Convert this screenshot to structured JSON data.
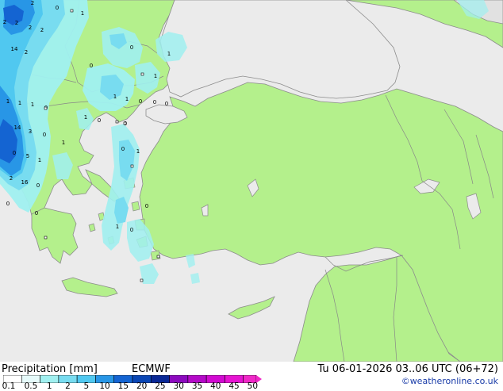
{
  "footer": {
    "title": "Precipitation [mm]",
    "model": "ECMWF",
    "valid_time": "Tu 06-01-2026 03..06 UTC (06+72)",
    "credit": "©weatheronline.co.uk"
  },
  "legend": {
    "labels": [
      "0.1",
      "0.5",
      "1",
      "2",
      "5",
      "10",
      "15",
      "20",
      "25",
      "30",
      "35",
      "40",
      "45",
      "50"
    ],
    "colors": [
      "#ffffff",
      "#e6fafa",
      "#a0f0f0",
      "#78dcf0",
      "#50c8f0",
      "#2896e6",
      "#1464d2",
      "#0a46b4",
      "#0a2896",
      "#8c0abe",
      "#b40ac8",
      "#d20ad2",
      "#e614d2",
      "#f028c8"
    ]
  },
  "map_labels": [
    {
      "text": "2"
    },
    {
      "text": "0"
    },
    {
      "text": "1"
    },
    {
      "text": "2"
    },
    {
      "text": "2"
    },
    {
      "text": "2"
    },
    {
      "text": "14"
    },
    {
      "text": "2"
    },
    {
      "text": "0"
    },
    {
      "text": "0"
    },
    {
      "text": "1"
    },
    {
      "text": "1"
    },
    {
      "text": "1"
    },
    {
      "text": "1"
    },
    {
      "text": "0"
    },
    {
      "text": "1"
    },
    {
      "text": "14"
    },
    {
      "text": "3"
    },
    {
      "text": "0"
    },
    {
      "text": "0"
    },
    {
      "text": "5"
    },
    {
      "text": "1"
    },
    {
      "text": "2"
    },
    {
      "text": "16"
    },
    {
      "text": "0"
    },
    {
      "text": "0"
    },
    {
      "text": "0"
    },
    {
      "text": "1"
    },
    {
      "text": "0"
    },
    {
      "text": "0"
    },
    {
      "text": "1"
    },
    {
      "text": "0"
    },
    {
      "text": "1"
    },
    {
      "text": "0"
    },
    {
      "text": "0"
    },
    {
      "text": "1"
    },
    {
      "text": "0"
    },
    {
      "text": "0"
    },
    {
      "text": "0"
    },
    {
      "text": "1"
    },
    {
      "text": "1"
    },
    {
      "text": "2"
    }
  ],
  "colors": {
    "land": "#b4f08c",
    "sea": "#ebebeb",
    "offmap": "#e1e1e1",
    "coast": "#8c8c8c",
    "border": "#888888"
  }
}
